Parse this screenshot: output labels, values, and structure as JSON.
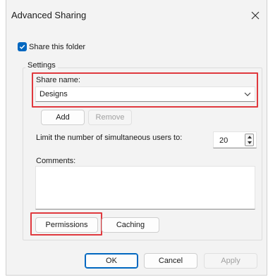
{
  "dialog": {
    "title": "Advanced Sharing",
    "close_icon": "close-icon"
  },
  "share_folder": {
    "label": "Share this folder",
    "checked": true
  },
  "settings": {
    "legend": "Settings",
    "share_name_label": "Share name:",
    "share_name_value": "Designs",
    "add_label": "Add",
    "remove_label": "Remove",
    "limit_label": "Limit the number of simultaneous users to:",
    "limit_value": "20",
    "comments_label": "Comments:",
    "comments_value": "",
    "permissions_label": "Permissions",
    "caching_label": "Caching"
  },
  "footer": {
    "ok_label": "OK",
    "cancel_label": "Cancel",
    "apply_label": "Apply"
  },
  "colors": {
    "accent": "#0067c0",
    "highlight": "#e0393e"
  }
}
